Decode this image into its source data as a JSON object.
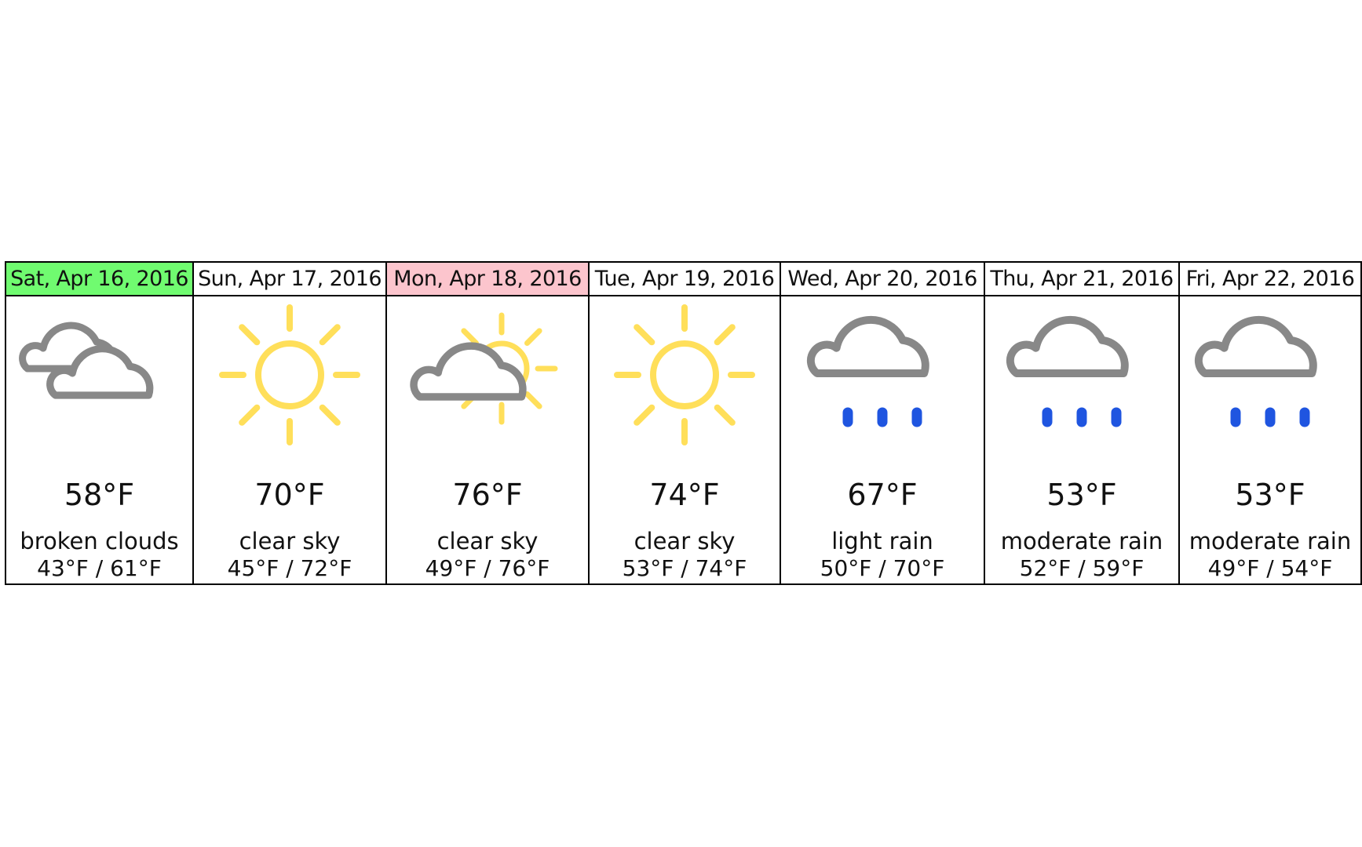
{
  "colors": {
    "today_highlight": "#70fb70",
    "selected_highlight": "#fcc5cd",
    "cloud": "#888888",
    "sun": "#ffdf5a",
    "rain": "#1f55e0"
  },
  "days": [
    {
      "date": "Sat, Apr 16, 2016",
      "icon": "broken-clouds-icon",
      "temp": "58°F",
      "desc": "broken clouds",
      "range": "43°F / 61°F",
      "highlight": "#70fb70"
    },
    {
      "date": "Sun, Apr 17, 2016",
      "icon": "clear-sky-icon",
      "temp": "70°F",
      "desc": "clear sky",
      "range": "45°F / 72°F",
      "highlight": ""
    },
    {
      "date": "Mon, Apr 18, 2016",
      "icon": "partly-cloudy-icon",
      "temp": "76°F",
      "desc": "clear sky",
      "range": "49°F / 76°F",
      "highlight": "#fcc5cd"
    },
    {
      "date": "Tue, Apr 19, 2016",
      "icon": "clear-sky-icon",
      "temp": "74°F",
      "desc": "clear sky",
      "range": "53°F / 74°F",
      "highlight": ""
    },
    {
      "date": "Wed, Apr 20, 2016",
      "icon": "rain-icon",
      "temp": "67°F",
      "desc": "light rain",
      "range": "50°F / 70°F",
      "highlight": ""
    },
    {
      "date": "Thu, Apr 21, 2016",
      "icon": "rain-icon",
      "temp": "53°F",
      "desc": "moderate rain",
      "range": "52°F / 59°F",
      "highlight": ""
    },
    {
      "date": "Fri, Apr 22, 2016",
      "icon": "rain-icon",
      "temp": "53°F",
      "desc": "moderate rain",
      "range": "49°F / 54°F",
      "highlight": ""
    }
  ]
}
